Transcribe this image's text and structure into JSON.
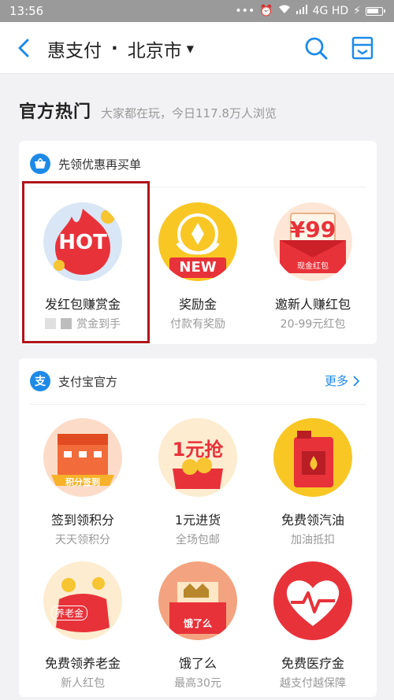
{
  "status": {
    "time": "13:56",
    "dots": "•••",
    "network": "4G HD"
  },
  "nav": {
    "title": "惠支付",
    "separator": "·",
    "city": "北京市",
    "caret": "▼"
  },
  "hot": {
    "title": "官方热门",
    "subtitle": "大家都在玩，今日117.8万人浏览"
  },
  "card1": {
    "header": "先领优惠再买单",
    "items": [
      {
        "name": "发红包赚赏金",
        "desc": "赏金到手",
        "badge": "HOT"
      },
      {
        "name": "奖励金",
        "desc": "付款有奖励",
        "badge": "NEW"
      },
      {
        "name": "邀新人赚红包",
        "desc": "20-99元红包",
        "badge": "¥99",
        "sub_badge": "现金红包"
      }
    ]
  },
  "card2": {
    "header": "支付宝官方",
    "header_icon": "支",
    "more": "更多",
    "items": [
      {
        "name": "签到领积分",
        "desc": "天天领积分",
        "badge": "积分签到"
      },
      {
        "name": "1元进货",
        "desc": "全场包邮",
        "badge": "1元抢"
      },
      {
        "name": "免费领汽油",
        "desc": "加油抵扣"
      },
      {
        "name": "免费领养老金",
        "desc": "新人红包",
        "badge": "养老金"
      },
      {
        "name": "饿了么",
        "desc": "最高30元",
        "badge": "饿了么"
      },
      {
        "name": "免费医疗金",
        "desc": "越支付越保障"
      }
    ]
  },
  "colors": {
    "brand_blue": "#1e8ae8",
    "hot_red": "#e8323a",
    "highlight_border": "#b1141b"
  }
}
